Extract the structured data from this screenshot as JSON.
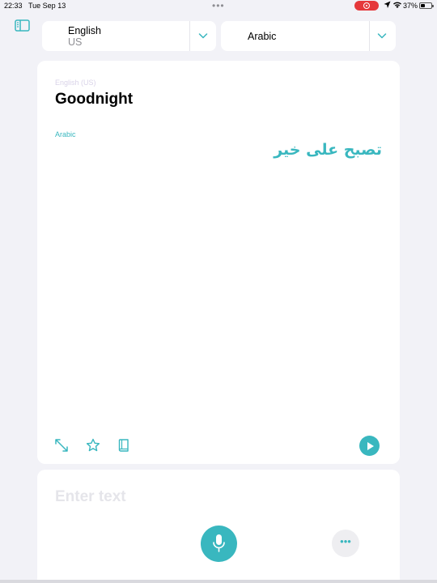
{
  "status_bar": {
    "time": "22:33",
    "date": "Tue Sep 13",
    "battery": "37%"
  },
  "source_language": {
    "name": "English",
    "region": "US"
  },
  "target_language": {
    "name": "Arabic"
  },
  "translation": {
    "source_label": "English (US)",
    "source_text": "Goodnight",
    "target_label": "Arabic",
    "target_text": "تصبح على خير"
  },
  "input": {
    "placeholder": "Enter text",
    "more_label": "•••"
  },
  "colors": {
    "accent": "#39b7bf",
    "background": "#f2f2f7",
    "recording": "#e5383b"
  },
  "icons": {
    "sidebar": "sidebar-icon",
    "chevron": "chevron-down-icon",
    "expand": "expand-icon",
    "favorite": "star-icon",
    "dictionary": "book-icon",
    "play": "play-icon",
    "microphone": "microphone-icon",
    "more": "ellipsis-icon"
  }
}
